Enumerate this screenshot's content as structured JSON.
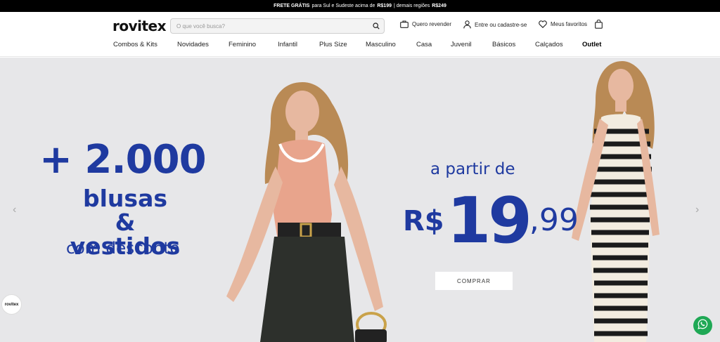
{
  "promo": {
    "bold1": "FRETE GRÁTIS",
    "text1": "para Sul e Sudeste acima de",
    "bold2": "R$199",
    "text2": "| demais regiões",
    "bold3": "R$249"
  },
  "header": {
    "logo": "rovitex",
    "search": {
      "placeholder": "O que você busca?",
      "icon": "search-icon"
    },
    "resell": {
      "label": "Quero revender",
      "icon": "briefcase-icon"
    },
    "account": {
      "label": "Entre ou cadastre-se",
      "icon": "user-icon"
    },
    "favorites": {
      "label": "Meus favoritos",
      "icon": "heart-icon"
    },
    "cart": {
      "icon": "bag-icon"
    }
  },
  "nav": {
    "items": [
      "Combos & Kits",
      "Novidades",
      "Feminino",
      "Infantil",
      "Plus Size",
      "Masculino",
      "Casa",
      "Juvenil",
      "Básicos",
      "Calçados",
      "Outlet"
    ]
  },
  "hero": {
    "line1": "+ 2.000",
    "line2a": "blusas",
    "line2b": "& vestidos",
    "line3": "com desconto",
    "from": "a partir de",
    "currency": "R$",
    "price_int": "19",
    "price_cents": ",99",
    "button": "COMPRAR",
    "accent_color": "#1f3aa0",
    "prev": "‹",
    "next": "›"
  },
  "floating": {
    "badge": "rovitex",
    "whatsapp_icon": "whatsapp-icon"
  }
}
